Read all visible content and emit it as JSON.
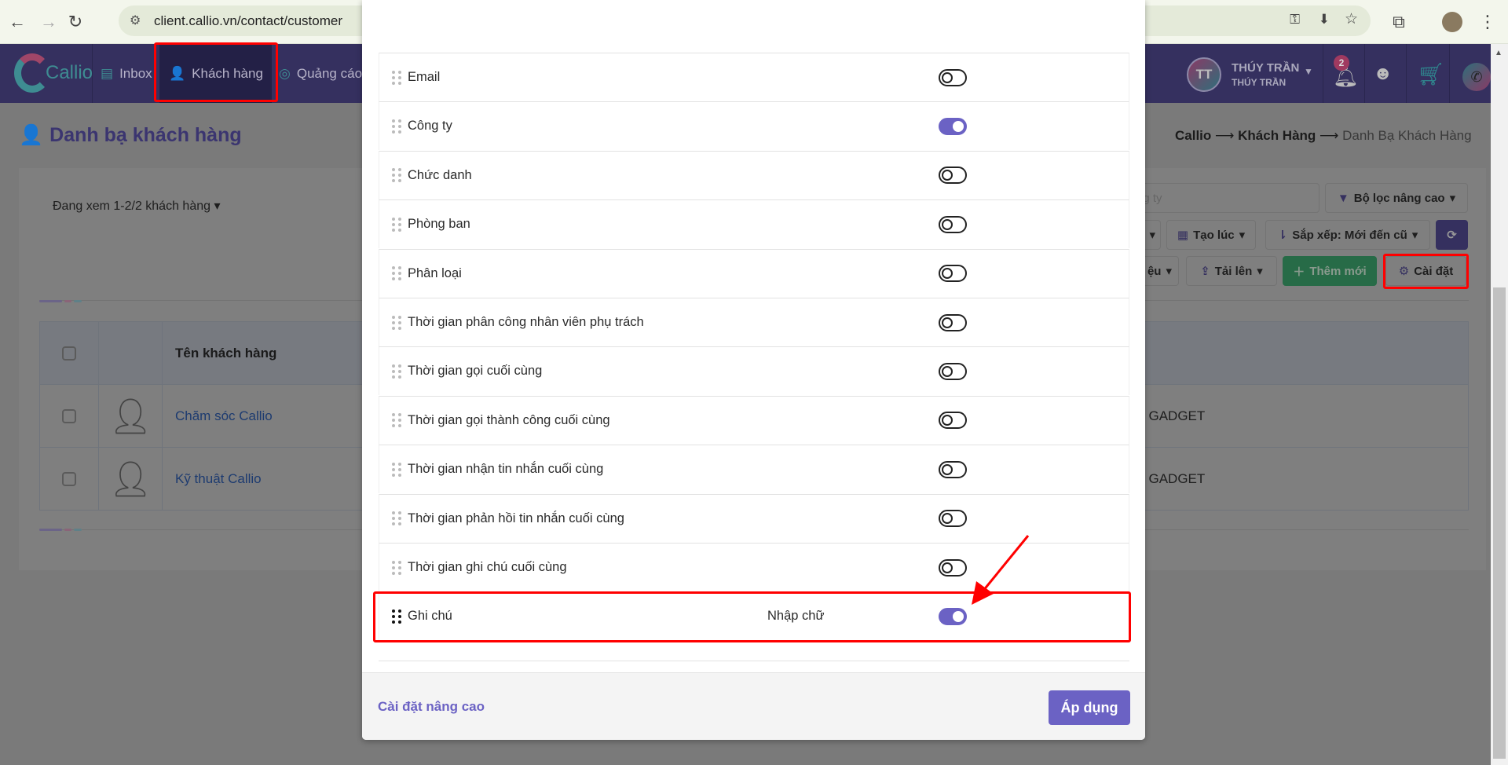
{
  "browser": {
    "url": "client.callio.vn/contact/customer"
  },
  "nav": {
    "logo": "Callio",
    "items": [
      {
        "label": "Inbox",
        "icon": "inbox-icon"
      },
      {
        "label": "Khách hàng",
        "icon": "user-search-icon",
        "active": true
      },
      {
        "label": "Quảng cáo",
        "icon": "target-icon"
      }
    ],
    "user": {
      "initials": "TT",
      "name": "THÚY TRẦN",
      "sub": "THÚY TRẦN"
    },
    "notifications": "2"
  },
  "page": {
    "title": "Danh bạ khách hàng",
    "breadcrumb": [
      "Callio",
      "Khách Hàng",
      "Danh Bạ Khách Hàng"
    ],
    "viewing": "Đang xem 1-2/2 khách hàng",
    "search_placeholder": "ng ty",
    "filter": "Bộ lọc nâng cao",
    "created": "Tạo lúc",
    "sort": "Sắp xếp: Mới đến cũ",
    "partial_btn": "ệu",
    "upload": "Tải lên",
    "add": "Thêm mới",
    "settings": "Cài đặt",
    "table": {
      "header": "Tên khách hàng",
      "rows": [
        {
          "name": "Chăm sóc Callio",
          "extra": "GADGET"
        },
        {
          "name": "Kỹ thuật Callio",
          "extra": "GADGET"
        }
      ]
    }
  },
  "modal": {
    "fields": [
      {
        "label": "Email",
        "on": false
      },
      {
        "label": "Công ty",
        "on": true
      },
      {
        "label": "Chức danh",
        "on": false
      },
      {
        "label": "Phòng ban",
        "on": false
      },
      {
        "label": "Phân loại",
        "on": false
      },
      {
        "label": "Thời gian phân công nhân viên phụ trách",
        "on": false
      },
      {
        "label": "Thời gian gọi cuối cùng",
        "on": false
      },
      {
        "label": "Thời gian gọi thành công cuối cùng",
        "on": false
      },
      {
        "label": "Thời gian nhận tin nhắn cuối cùng",
        "on": false
      },
      {
        "label": "Thời gian phản hồi tin nhắn cuối cùng",
        "on": false
      },
      {
        "label": "Thời gian ghi chú cuối cùng",
        "on": false
      },
      {
        "label": "Ghi chú",
        "on": true,
        "type": "Nhập chữ"
      }
    ],
    "advanced": "Cài đặt nâng cao",
    "apply": "Áp dụng"
  },
  "colors": {
    "accent": "#6b62c4",
    "nav": "#35305f",
    "highlight": "#ff0000",
    "add": "#276b47"
  }
}
